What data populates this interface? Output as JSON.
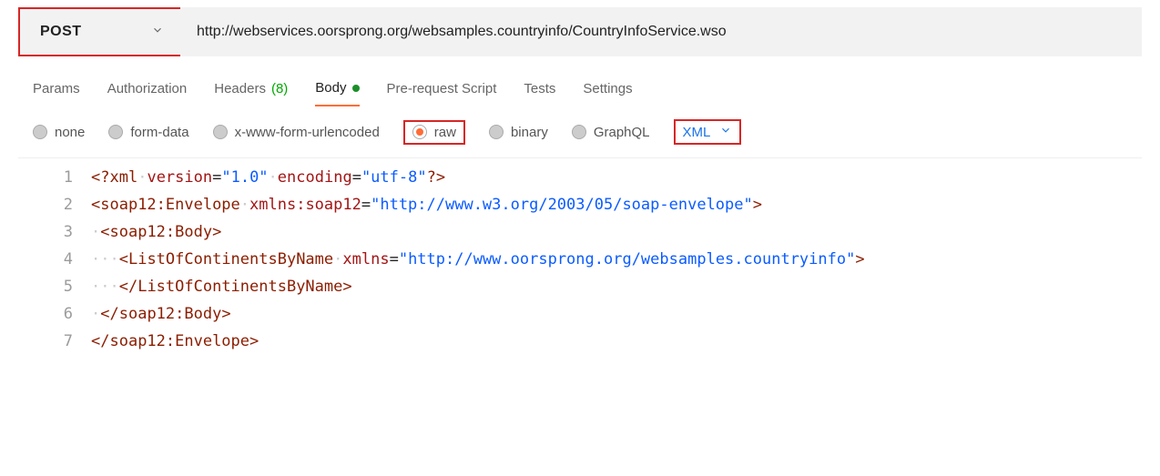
{
  "method": "POST",
  "url": "http://webservices.oorsprong.org/websamples.countryinfo/CountryInfoService.wso",
  "tabs": [
    {
      "label": "Params",
      "active": false
    },
    {
      "label": "Authorization",
      "active": false
    },
    {
      "label": "Headers",
      "count": "(8)",
      "active": false
    },
    {
      "label": "Body",
      "dot": true,
      "active": true
    },
    {
      "label": "Pre-request Script",
      "active": false
    },
    {
      "label": "Tests",
      "active": false
    },
    {
      "label": "Settings",
      "active": false
    }
  ],
  "bodyTypes": {
    "none": "none",
    "formdata": "form-data",
    "urlencoded": "x-www-form-urlencoded",
    "raw": "raw",
    "binary": "binary",
    "graphql": "GraphQL"
  },
  "formatSelect": "XML",
  "lineNumbers": [
    "1",
    "2",
    "3",
    "4",
    "5",
    "6",
    "7"
  ],
  "code": {
    "l1": {
      "piOpen": "<?",
      "tag": "xml",
      "sp": "·",
      "attr1": "version",
      "eq": "=",
      "val1": "\"1.0\"",
      "sp2": "·",
      "attr2": "encoding",
      "val2": "\"utf-8\"",
      "piClose": "?>"
    },
    "l2": {
      "open": "<",
      "tag": "soap12:Envelope",
      "sp": "·",
      "attr": "xmlns:soap12",
      "eq": "=",
      "val": "\"http://www.w3.org/2003/05/soap-envelope\"",
      "close": ">"
    },
    "l3": {
      "dots": "·",
      "open": "<",
      "tag": "soap12:Body",
      "close": ">"
    },
    "l4": {
      "dots": "···",
      "open": "<",
      "tag": "ListOfContinentsByName",
      "sp": "·",
      "attr": "xmlns",
      "eq": "=",
      "val": "\"http://www.oorsprong.org/websamples.countryinfo\"",
      "close": ">"
    },
    "l5": {
      "dots": "···",
      "open": "</",
      "tag": "ListOfContinentsByName",
      "close": ">"
    },
    "l6": {
      "dots": "·",
      "open": "</",
      "tag": "soap12:Body",
      "close": ">"
    },
    "l7": {
      "open": "</",
      "tag": "soap12:Envelope",
      "close": ">"
    }
  }
}
